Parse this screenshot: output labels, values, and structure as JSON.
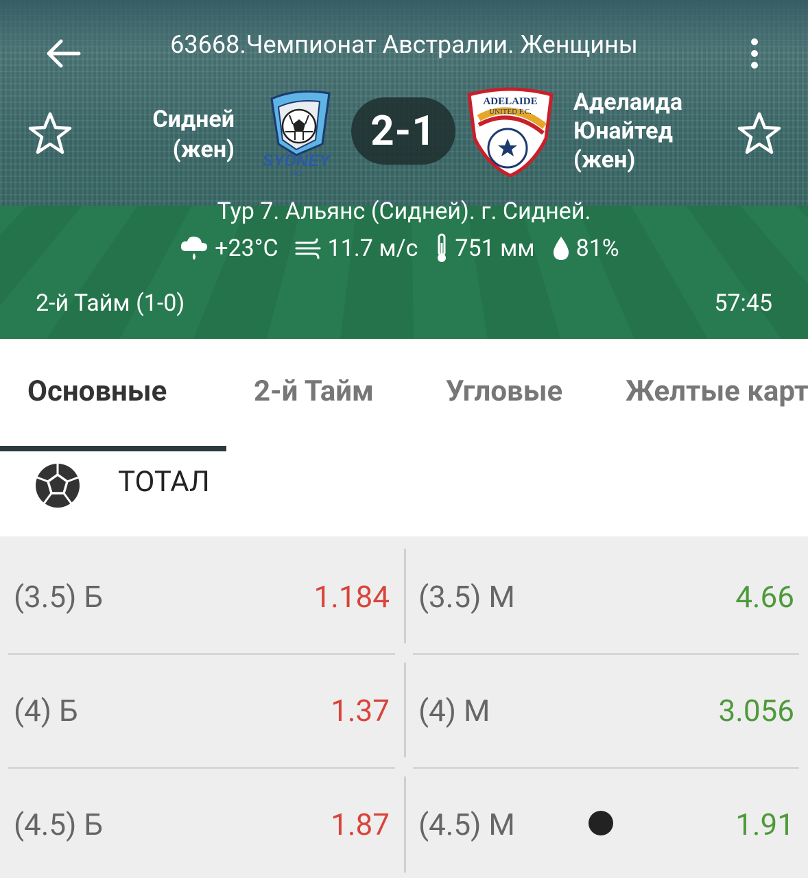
{
  "header": {
    "title": "63668.Чемпионат Австралии. Женщины",
    "team_home": "Сидней (жен)",
    "team_home_line1": "Сидней",
    "team_home_line2": "(жен)",
    "team_away_line1": "Аделаида",
    "team_away_line2": "Юнайтед",
    "team_away_line3": "(жен)",
    "score": "2-1",
    "venue": "Тур 7. Альянс (Сидней). г. Сидней.",
    "weather": {
      "temperature": "+23°C",
      "wind": "11.7 м/с",
      "pressure": "751 мм",
      "humidity": "81%"
    },
    "period": "2-й  Тайм (1-0)",
    "clock": "57:45",
    "home_logo_text": "SYDNEY",
    "home_logo_sub": "FC",
    "away_logo_text": "ADELAIDE",
    "away_logo_sub": "UNITED F.C."
  },
  "tabs": [
    "Основные",
    "2-й  Тайм",
    "Угловые",
    "Желтые карточки"
  ],
  "active_tab": "Основные",
  "section": {
    "title": "ТОТАЛ",
    "icon": "soccer-ball-icon"
  },
  "odds": [
    {
      "over_label": "(3.5) Б",
      "over_value": "1.184",
      "under_label": "(3.5) М",
      "under_value": "4.66"
    },
    {
      "over_label": "(4) Б",
      "over_value": "1.37",
      "under_label": "(4) М",
      "under_value": "3.056"
    },
    {
      "over_label": "(4.5) Б",
      "over_value": "1.87",
      "under_label": "(4.5) М",
      "under_value": "1.91"
    }
  ],
  "colors": {
    "over": "#d9443a",
    "under": "#4e9a3a",
    "tab_indicator": "#2a3a3f"
  }
}
